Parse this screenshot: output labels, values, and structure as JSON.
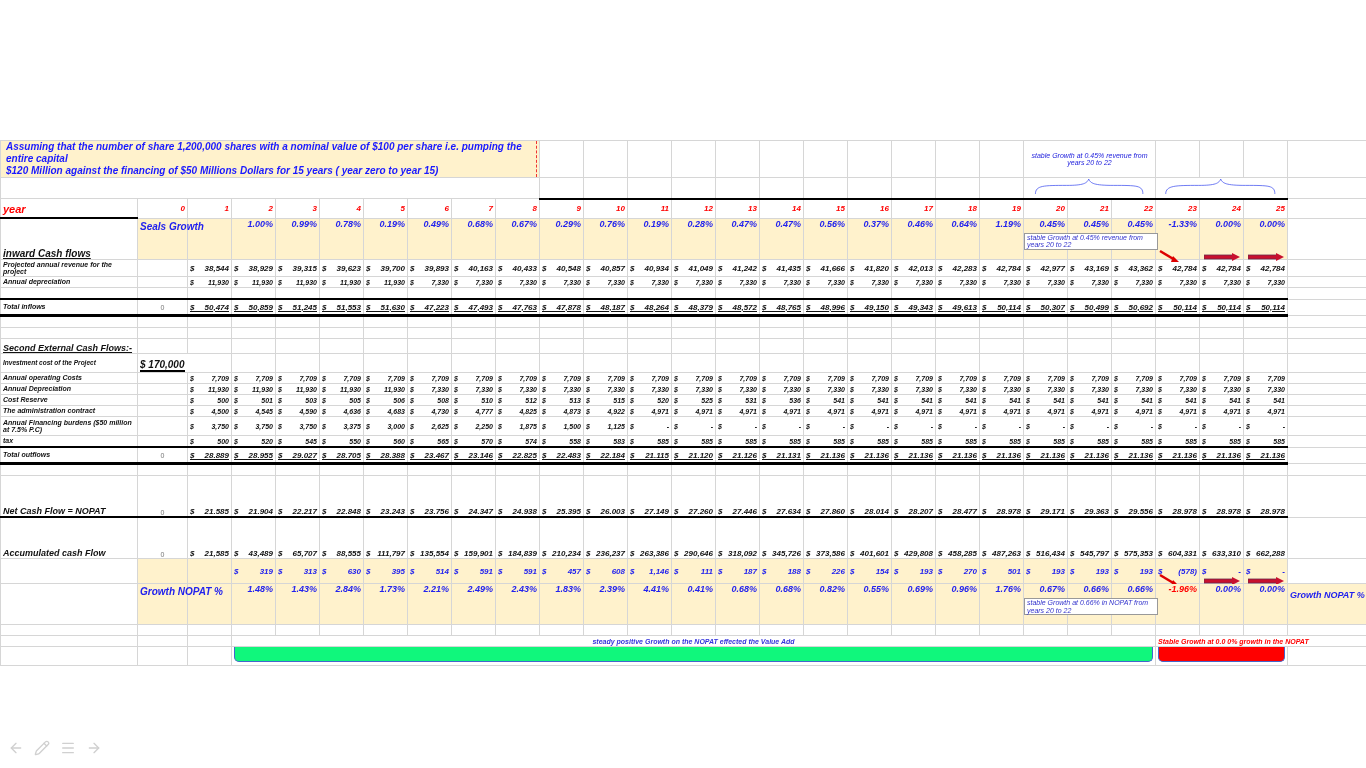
{
  "note_lines": [
    "Assuming that the number of share 1,200,000 shares with a nominal value of $100 per share  i.e. pumping the entire capital",
    "$120 Million against the financing of $50 Millions Dollars for 15  years ( year zero to year 15)"
  ],
  "top_note": "stable Growth at 0.45%  revenue from  years 20  to 22",
  "years_label": "year",
  "years": [
    "0",
    "1",
    "2",
    "3",
    "4",
    "5",
    "6",
    "7",
    "8",
    "9",
    "10",
    "11",
    "12",
    "13",
    "14",
    "15",
    "16",
    "17",
    "18",
    "19",
    "20",
    "21",
    "22",
    "23",
    "24",
    "25"
  ],
  "rows": [
    {
      "kind": "growth",
      "label": "inward Cash flows",
      "title": "Seals Growth",
      "cells": [
        null,
        null,
        "1.00%",
        "0.99%",
        "0.78%",
        "0.19%",
        "0.49%",
        "0.68%",
        "0.67%",
        "0.29%",
        "0.76%",
        "0.19%",
        "0.28%",
        "0.47%",
        "0.47%",
        "0.56%",
        "0.37%",
        "0.46%",
        "0.64%",
        "1.19%",
        {
          "text": "0.45%",
          "note": "stable Growth at 0.45%  revenue from years 20 to 22"
        },
        "0.45%",
        "0.45%",
        {
          "text": "-1.33%",
          "kind": "down"
        },
        {
          "text": "0.00%",
          "kind": "right"
        },
        {
          "text": "0.00%",
          "kind": "right"
        }
      ]
    },
    {
      "kind": "money",
      "label": "Projected annual revenue for the project",
      "cells": [
        null,
        "$ 38,544",
        "$ 38,929",
        "$ 39,315",
        "$ 39,623",
        "$ 39,700",
        "$ 39,893",
        "$ 40,163",
        "$ 40,433",
        "$ 40,548",
        "$ 40,857",
        "$ 40,934",
        "$ 41,049",
        "$ 41,242",
        "$ 41,435",
        "$ 41,666",
        "$ 41,820",
        "$ 42,013",
        "$ 42,283",
        "$ 42,784",
        "$ 42,977",
        "$ 43,169",
        "$ 43,362",
        "$ 42,784",
        "$ 42,784",
        "$ 42,784"
      ]
    },
    {
      "kind": "small",
      "label": "Annual depreciation",
      "cells": [
        null,
        "$ 11,930",
        "$ 11,930",
        "$ 11,930",
        "$ 11,930",
        "$ 11,930",
        "$ 7,330",
        "$ 7,330",
        "$ 7,330",
        "$ 7,330",
        "$ 7,330",
        "$ 7,330",
        "$ 7,330",
        "$ 7,330",
        "$ 7,330",
        "$ 7,330",
        "$ 7,330",
        "$ 7,330",
        "$ 7,330",
        "$ 7,330",
        "$ 7,330",
        "$ 7,330",
        "$ 7,330",
        "$ 7,330",
        "$ 7,330",
        "$ 7,330"
      ]
    },
    {
      "kind": "blank"
    },
    {
      "kind": "total",
      "label": "Total inflows",
      "cells": [
        "0",
        "$ 50,474",
        "$ 50,859",
        "$ 51,245",
        "$ 51,553",
        "$ 51,630",
        "$ 47,223",
        "$ 47,493",
        "$ 47,763",
        "$ 47,878",
        "$ 48,187",
        "$ 48,264",
        "$ 48,379",
        "$ 48,572",
        "$ 48,765",
        "$ 48,996",
        "$ 49,150",
        "$ 49,343",
        "$ 49,613",
        "$ 50,114",
        "$ 50,307",
        "$ 50,499",
        "$ 50,692",
        "$ 50,114",
        "$ 50,114",
        "$ 50,114"
      ]
    },
    {
      "kind": "blank"
    },
    {
      "kind": "blank"
    },
    {
      "kind": "heading",
      "label": "Second External Cash Flows:-"
    },
    {
      "kind": "investment",
      "label": "Investment cost of the Project",
      "cells": [
        "$ 170,000"
      ]
    },
    {
      "kind": "small",
      "label": "Annual operating Costs",
      "cells": [
        null,
        "$ 7,709",
        "$ 7,709",
        "$ 7,709",
        "$ 7,709",
        "$ 7,709",
        "$ 7,709",
        "$ 7,709",
        "$ 7,709",
        "$ 7,709",
        "$ 7,709",
        "$ 7,709",
        "$ 7,709",
        "$ 7,709",
        "$ 7,709",
        "$ 7,709",
        "$ 7,709",
        "$ 7,709",
        "$ 7,709",
        "$ 7,709",
        "$ 7,709",
        "$ 7,709",
        "$ 7,709",
        "$ 7,709",
        "$ 7,709",
        "$ 7,709"
      ]
    },
    {
      "kind": "small",
      "label": "Annual Depreciation",
      "cells": [
        null,
        "$ 11,930",
        "$ 11,930",
        "$ 11,930",
        "$ 11,930",
        "$ 11,930",
        "$ 7,330",
        "$ 7,330",
        "$ 7,330",
        "$ 7,330",
        "$ 7,330",
        "$ 7,330",
        "$ 7,330",
        "$ 7,330",
        "$ 7,330",
        "$ 7,330",
        "$ 7,330",
        "$ 7,330",
        "$ 7,330",
        "$ 7,330",
        "$ 7,330",
        "$ 7,330",
        "$ 7,330",
        "$ 7,330",
        "$ 7,330",
        "$ 7,330"
      ]
    },
    {
      "kind": "small",
      "label": "Cost Reserve",
      "cells": [
        null,
        "$ 500",
        "$ 501",
        "$ 503",
        "$ 505",
        "$ 506",
        "$ 508",
        "$ 510",
        "$ 512",
        "$ 513",
        "$ 515",
        "$ 520",
        "$ 525",
        "$ 531",
        "$ 536",
        "$ 541",
        "$ 541",
        "$ 541",
        "$ 541",
        "$ 541",
        "$ 541",
        "$ 541",
        "$ 541",
        "$ 541",
        "$ 541",
        "$ 541"
      ]
    },
    {
      "kind": "small",
      "label": "The administration contract",
      "cells": [
        null,
        "$ 4,500",
        "$ 4,545",
        "$ 4,590",
        "$ 4,636",
        "$ 4,683",
        "$ 4,730",
        "$ 4,777",
        "$ 4,825",
        "$ 4,873",
        "$ 4,922",
        "$ 4,971",
        "$ 4,971",
        "$ 4,971",
        "$ 4,971",
        "$ 4,971",
        "$ 4,971",
        "$ 4,971",
        "$ 4,971",
        "$ 4,971",
        "$ 4,971",
        "$ 4,971",
        "$ 4,971",
        "$ 4,971",
        "$ 4,971",
        "$ 4,971"
      ]
    },
    {
      "kind": "small",
      "label": "Annual Financing burdens ($50 million at 7.5% P.C)",
      "cells": [
        null,
        "$ 3,750",
        "$ 3,750",
        "$ 3,750",
        "$ 3,375",
        "$ 3,000",
        "$ 2,625",
        "$ 2,250",
        "$ 1,875",
        "$ 1,500",
        "$ 1,125",
        "$ -",
        "$ -",
        "$ -",
        "$ -",
        "$ -",
        "$ -",
        "$ -",
        "$ -",
        "$ -",
        "$ -",
        "$ -",
        "$ -",
        "$ -",
        "$ -",
        "$ -"
      ]
    },
    {
      "kind": "small",
      "label": "tax",
      "cells": [
        null,
        "$ 500",
        "$ 520",
        "$ 545",
        "$ 550",
        "$ 560",
        "$ 565",
        "$ 570",
        "$ 574",
        "$ 558",
        "$ 583",
        "$ 585",
        "$ 585",
        "$ 585",
        "$ 585",
        "$ 585",
        "$ 585",
        "$ 585",
        "$ 585",
        "$ 585",
        "$ 585",
        "$ 585",
        "$ 585",
        "$ 585",
        "$ 585",
        "$ 585"
      ]
    },
    {
      "kind": "total",
      "label": "Total outflows",
      "cells": [
        "0",
        "$ 28.889",
        "$ 28.955",
        "$ 29.027",
        "$ 28.705",
        "$ 28.388",
        "$ 23.467",
        "$ 23.146",
        "$ 22.825",
        "$ 22.483",
        "$ 22.184",
        "$ 21.115",
        "$ 21.120",
        "$ 21.126",
        "$ 21.131",
        "$ 21.136",
        "$ 21.136",
        "$ 21.136",
        "$ 21.136",
        "$ 21.136",
        "$ 21.136",
        "$ 21.136",
        "$ 21.136",
        "$ 21.136",
        "$ 21.136",
        "$ 21.136"
      ]
    },
    {
      "kind": "blank"
    },
    {
      "kind": "result",
      "label": "Net Cash Flow = NOPAT",
      "cells": [
        "0",
        "$ 21.585",
        "$ 21.904",
        "$ 22.217",
        "$ 22.848",
        "$ 23.243",
        "$ 23.756",
        "$ 24.347",
        "$ 24.938",
        "$ 25.395",
        "$ 26.003",
        "$ 27.149",
        "$ 27.260",
        "$ 27.446",
        "$ 27.634",
        "$ 27.860",
        "$ 28.014",
        "$ 28.207",
        "$ 28.477",
        "$ 28.978",
        "$ 29.171",
        "$ 29.363",
        "$ 29.556",
        "$ 28.978",
        "$ 28.978",
        "$ 28.978"
      ]
    },
    {
      "kind": "result",
      "label": "Accumulated cash Flow",
      "cells": [
        "0",
        "$ 21,585",
        "$ 43,489",
        "$ 65,707",
        "$ 88,555",
        "$ 111,797",
        "$ 135,554",
        "$ 159,901",
        "$ 184,839",
        "$ 210,234",
        "$ 236,237",
        "$ 263,386",
        "$ 290,646",
        "$ 318,092",
        "$ 345,726",
        "$ 373,586",
        "$ 401,601",
        "$ 429,808",
        "$ 458,285",
        "$ 487,263",
        "$ 516,434",
        "$ 545,797",
        "$ 575,353",
        "$ 604,331",
        "$ 633,310",
        "$ 662,288"
      ]
    },
    {
      "kind": "change",
      "cells": [
        null,
        null,
        "$ 319",
        "$ 313",
        "$ 630",
        "$ 395",
        "$ 514",
        "$ 591",
        "$ 591",
        "$ 457",
        "$ 608",
        "$ 1,146",
        "$ 111",
        "$ 187",
        "$ 188",
        "$ 226",
        "$ 154",
        "$ 193",
        "$ 270",
        "$ 501",
        "$ 193",
        "$ 193",
        "$ 193",
        {
          "text": "$ (578)",
          "kind": "down"
        },
        {
          "text": "$ -",
          "kind": "right"
        },
        {
          "text": "$ -",
          "kind": "right"
        }
      ]
    },
    {
      "kind": "pct",
      "title": "Growth NOPAT %",
      "trailing": "Growth NOPAT %",
      "cells": [
        null,
        null,
        "1.48%",
        "1.43%",
        "2.84%",
        "1.73%",
        "2.21%",
        "2.49%",
        "2.43%",
        "1.83%",
        "2.39%",
        "4.41%",
        "0.41%",
        "0.68%",
        "0.68%",
        "0.82%",
        "0.55%",
        "0.69%",
        "0.96%",
        "1.76%",
        {
          "text": "0.67%",
          "note": "stable Growth at 0.66%  in NOPAT from years 20 to 22"
        },
        "0.66%",
        "0.66%",
        {
          "text": "-1.96%",
          "alert": true
        },
        "0.00%",
        "0.00%"
      ]
    },
    {
      "kind": "blank"
    }
  ],
  "callouts": [
    {
      "kind": "positive",
      "text": "steady positive Growth on the NOPAT effected  the Value Add",
      "color": "#10f77c"
    },
    {
      "kind": "negative",
      "text": "Stable Growth  at 0.0 0% growth in the  NOPAT",
      "color": "#ff0000"
    }
  ]
}
